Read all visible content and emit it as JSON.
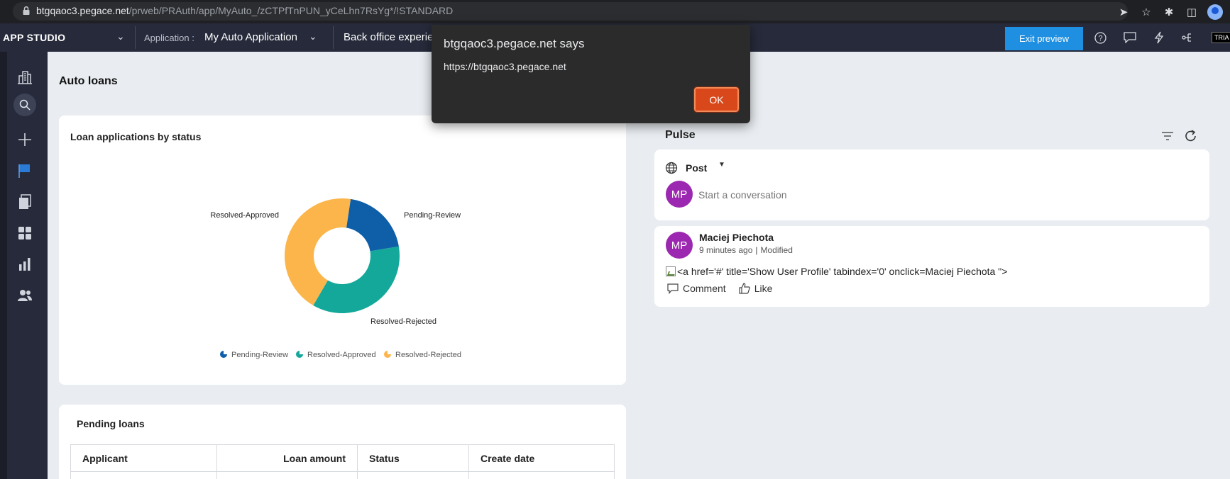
{
  "browser": {
    "url_host": "btgqaoc3.pegace.net",
    "url_path": "/prweb/PRAuth/app/MyAuto_/zCTPfTnPUN_yCeLhn7RsYg*/!STANDARD"
  },
  "header": {
    "studio": "APP STUDIO",
    "application_label": "Application :",
    "application_name": "My Auto Application",
    "portal_name": "Back office experie",
    "exit_preview": "Exit preview",
    "trial_badge": "TRIA"
  },
  "page": {
    "title": "Auto loans"
  },
  "chart_card": {
    "title": "Loan applications by status"
  },
  "chart_data": {
    "type": "pie",
    "categories": [
      "Pending-Review",
      "Resolved-Approved",
      "Resolved-Rejected"
    ],
    "values": [
      20,
      36,
      44
    ],
    "colors": [
      "#0f5ea8",
      "#14a89a",
      "#fcb54a"
    ],
    "legend": "bottom"
  },
  "pending": {
    "title": "Pending loans",
    "columns": [
      "Applicant",
      "Loan amount",
      "Status",
      "Create date"
    ]
  },
  "pulse": {
    "title": "Pulse",
    "post_label": "Post",
    "post_placeholder": "Start a conversation",
    "avatar_initials": "MP",
    "feed": {
      "author": "Maciej Piechota",
      "initials": "MP",
      "time": "9 minutes ago",
      "status": "Modified",
      "message": "<a href='#' title='Show User Profile' tabindex='0' onclick=Maciej Piechota \">",
      "comment_label": "Comment",
      "like_label": "Like"
    }
  },
  "dialog": {
    "title": "btgqaoc3.pegace.net says",
    "message": "https://btgqaoc3.pegace.net",
    "ok_label": "OK"
  }
}
